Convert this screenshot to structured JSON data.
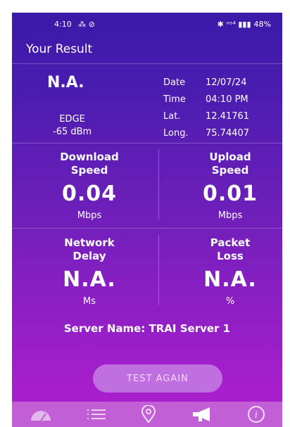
{
  "status_bar": {
    "time": "4:10",
    "left_icons": "⁂ ⊘",
    "right_icons": "✱ ᵛᵒ⁴ ▮▮▮",
    "battery": "48%"
  },
  "app_bar": {
    "title": "Your Result"
  },
  "summary": {
    "network_value": "N.A.",
    "network_type": "EDGE",
    "signal": "-65 dBm",
    "details": [
      {
        "key": "Date",
        "value": "12/07/24"
      },
      {
        "key": "Time",
        "value": "04:10 PM"
      },
      {
        "key": "Lat.",
        "value": "12.41761"
      },
      {
        "key": "Long.",
        "value": "75.74407"
      }
    ]
  },
  "speed": {
    "download": {
      "label_line1": "Download",
      "label_line2": "Speed",
      "value": "0.04",
      "unit": "Mbps"
    },
    "upload": {
      "label_line1": "Upload",
      "label_line2": "Speed",
      "value": "0.01",
      "unit": "Mbps"
    }
  },
  "quality": {
    "delay": {
      "label_line1": "Network",
      "label_line2": "Delay",
      "value": "N.A.",
      "unit": "Ms"
    },
    "loss": {
      "label_line1": "Packet",
      "label_line2": "Loss",
      "value": "N.A.",
      "unit": "%"
    }
  },
  "server": {
    "text": "Server Name: TRAI Server 1"
  },
  "button": {
    "label": "TEST AGAIN"
  },
  "nav": {
    "items": [
      "speedometer-icon",
      "list-icon",
      "location-pin-icon",
      "megaphone-icon",
      "info-icon"
    ]
  }
}
